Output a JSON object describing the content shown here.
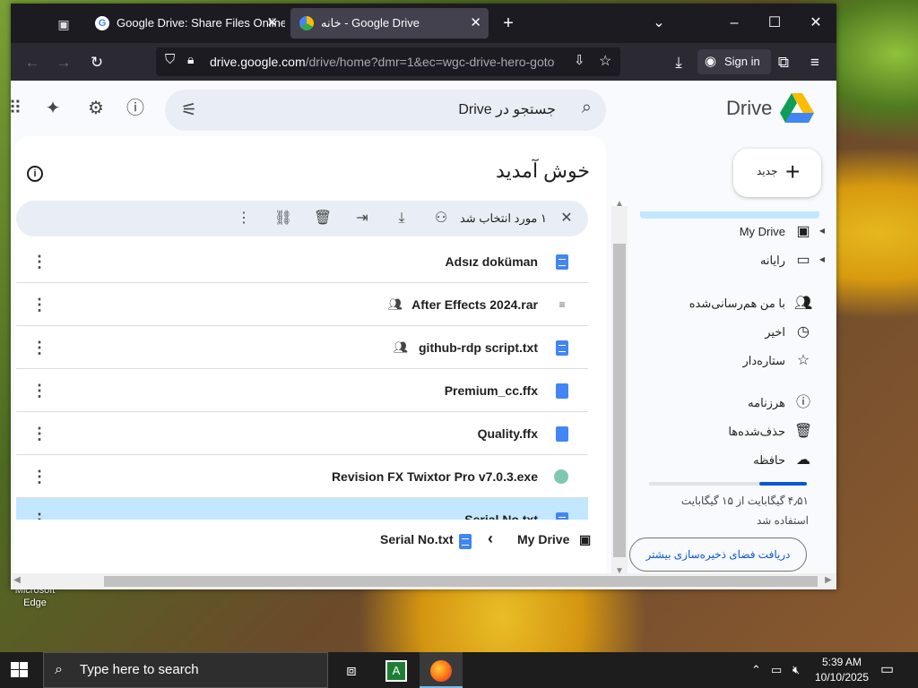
{
  "desktop": {
    "icon_label": "Microsoft Edge"
  },
  "browser": {
    "tabs": [
      {
        "title": "Google Drive: Share Files Online",
        "favicon": "google-g-icon"
      },
      {
        "title": "خانه - Google Drive",
        "favicon": "drive-icon"
      }
    ],
    "url_domain": "drive.google.com",
    "url_path": "/drive/home?dmr=1&ec=wgc-drive-hero-goto",
    "signin_label": "Sign in"
  },
  "drive": {
    "logo_text": "Drive",
    "search_placeholder": "جستجو در Drive",
    "welcome": "خوش آمدید",
    "selection_text": "۱ مورد انتخاب شد",
    "new_label": "جدید",
    "files": [
      {
        "name": "Adsız doküman",
        "icon": "doc",
        "shared": false
      },
      {
        "name": "After Effects 2024.rar",
        "icon": "archive",
        "shared": true
      },
      {
        "name": "github-rdp script.txt",
        "icon": "doc",
        "shared": true
      },
      {
        "name": "Premium_cc.ffx",
        "icon": "file",
        "shared": false
      },
      {
        "name": "Quality.ffx",
        "icon": "file",
        "shared": false
      },
      {
        "name": "Revision FX Twixtor Pro v7.0.3.exe",
        "icon": "exe",
        "shared": false
      },
      {
        "name": "Serial No.txt",
        "icon": "doc",
        "shared": false,
        "selected": true
      }
    ],
    "breadcrumb": {
      "root": "My Drive",
      "current": "Serial No.txt"
    },
    "nav": [
      {
        "label": "My Drive",
        "icon": "my-drive-icon",
        "caret": true
      },
      {
        "label": "رایانه",
        "icon": "computer-icon",
        "caret": true
      },
      {
        "label": "با من هم‌رسانی‌شده",
        "icon": "shared-icon"
      },
      {
        "label": "اخیر",
        "icon": "clock-icon"
      },
      {
        "label": "ستاره‌دار",
        "icon": "star-icon"
      },
      {
        "label": "هرزنامه",
        "icon": "spam-icon"
      },
      {
        "label": "حذف‌شده‌ها",
        "icon": "trash-icon"
      },
      {
        "label": "حافظه",
        "icon": "cloud-icon"
      }
    ],
    "storage": {
      "used_text": "۴٫۵۱ گیگابایت از ۱۵ گیگابایت استفاده شد",
      "used_fraction": 0.3,
      "button_label": "دریافت فضای ذخیره‌سازی بیشتر"
    }
  },
  "taskbar": {
    "search_placeholder": "Type here to search",
    "time": "5:39 AM",
    "date": "10/10/2025"
  }
}
